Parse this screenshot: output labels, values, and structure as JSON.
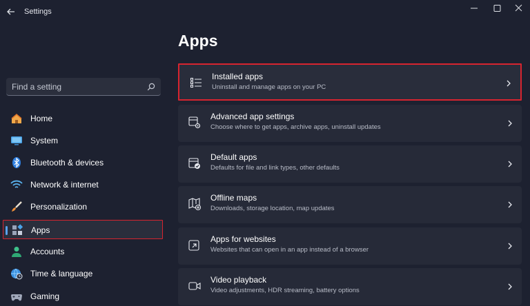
{
  "window": {
    "title": "Settings",
    "back_icon": "arrow-left-icon",
    "controls": [
      "minimize-icon",
      "maximize-icon",
      "close-icon"
    ]
  },
  "search": {
    "placeholder": "Find a setting",
    "icon": "search-icon"
  },
  "sidebar": {
    "items": [
      {
        "label": "Home",
        "icon": "home-icon",
        "active": false
      },
      {
        "label": "System",
        "icon": "monitor-icon",
        "active": false
      },
      {
        "label": "Bluetooth & devices",
        "icon": "bluetooth-icon",
        "active": false
      },
      {
        "label": "Network & internet",
        "icon": "wifi-icon",
        "active": false
      },
      {
        "label": "Personalization",
        "icon": "brush-icon",
        "active": false
      },
      {
        "label": "Apps",
        "icon": "apps-icon",
        "active": true
      },
      {
        "label": "Accounts",
        "icon": "person-icon",
        "active": false
      },
      {
        "label": "Time & language",
        "icon": "globe-clock-icon",
        "active": false
      },
      {
        "label": "Gaming",
        "icon": "gamepad-icon",
        "active": false
      }
    ]
  },
  "main": {
    "title": "Apps",
    "cards": [
      {
        "title": "Installed apps",
        "subtitle": "Uninstall and manage apps on your PC",
        "icon": "list-icon",
        "highlighted": true
      },
      {
        "title": "Advanced app settings",
        "subtitle": "Choose where to get apps, archive apps, uninstall updates",
        "icon": "app-gear-icon",
        "highlighted": false
      },
      {
        "title": "Default apps",
        "subtitle": "Defaults for file and link types, other defaults",
        "icon": "default-apps-icon",
        "highlighted": false
      },
      {
        "title": "Offline maps",
        "subtitle": "Downloads, storage location, map updates",
        "icon": "map-icon",
        "highlighted": false
      },
      {
        "title": "Apps for websites",
        "subtitle": "Websites that can open in an app instead of a browser",
        "icon": "website-app-icon",
        "highlighted": false
      },
      {
        "title": "Video playback",
        "subtitle": "Video adjustments, HDR streaming, battery options",
        "icon": "video-icon",
        "highlighted": false
      }
    ]
  },
  "colors": {
    "background": "#1d2130",
    "card": "#262a38",
    "highlight_border": "#d8242f",
    "accent": "#5aa3f0"
  }
}
